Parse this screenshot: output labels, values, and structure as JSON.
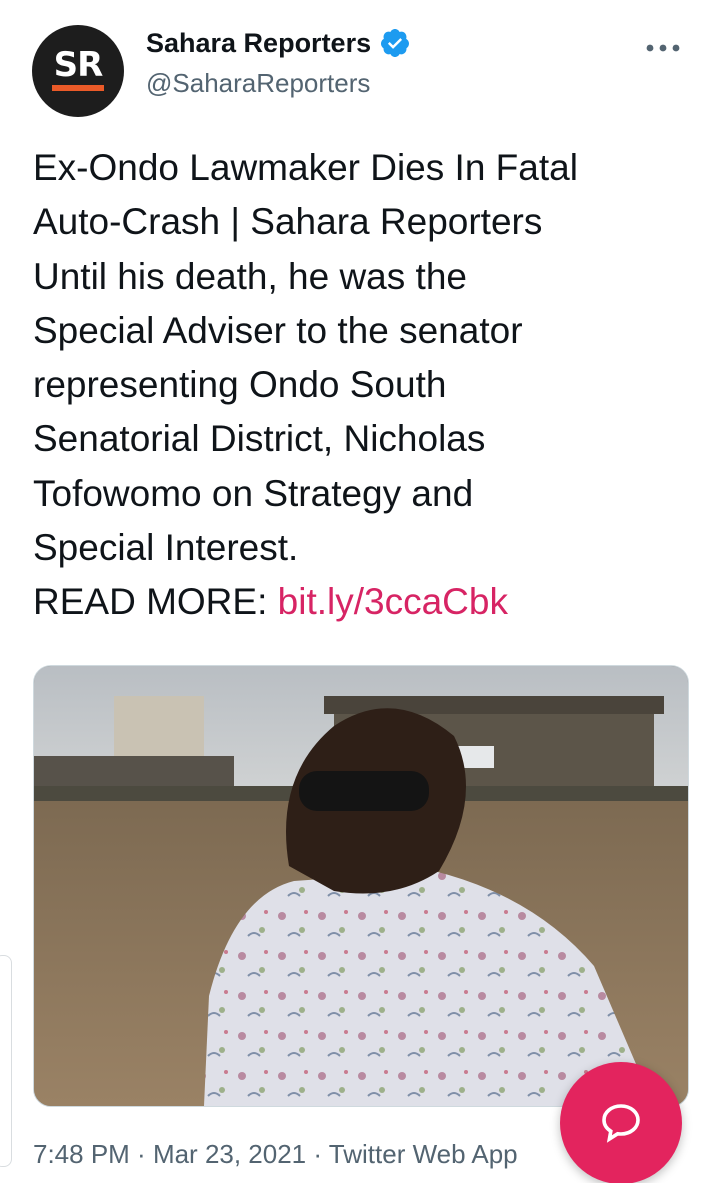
{
  "author": {
    "avatar_text": "SR",
    "display_name": "Sahara Reporters",
    "handle": "@SaharaReporters",
    "verified": true
  },
  "tweet": {
    "lines": [
      "Ex-Ondo Lawmaker Dies In Fatal",
      "Auto-Crash | Sahara Reporters",
      "Until his death, he was the",
      "Special Adviser to the senator",
      "representing Ondo South",
      "Senatorial District, Nicholas",
      "Tofowomo on Strategy and",
      "Special Interest."
    ],
    "read_more_label": "READ MORE: ",
    "link_text": "bit.ly/3ccaCbk"
  },
  "meta": {
    "time": "7:48 PM",
    "date": "Mar 23, 2021",
    "source": "Twitter Web App",
    "separator": " · "
  },
  "icons": {
    "more": "more-horizontal-icon",
    "verified": "verified-badge-icon",
    "compose": "reply-bubble-icon"
  },
  "colors": {
    "link": "#d72464",
    "verified": "#1d9bf0",
    "fab": "#e3245e",
    "brand_bar": "#ea5a28"
  }
}
